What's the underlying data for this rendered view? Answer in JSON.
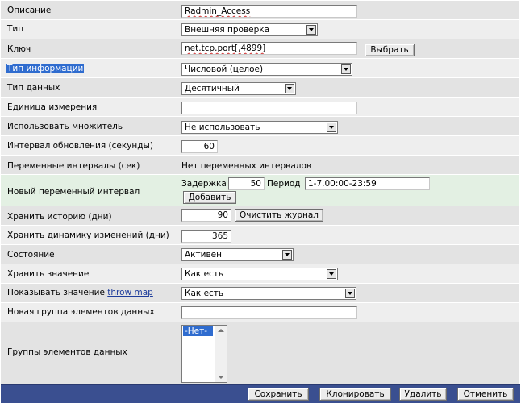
{
  "form": {
    "description": {
      "label": "Описание",
      "value": "Radmin_Access"
    },
    "type": {
      "label": "Тип",
      "value": "Внешняя проверка"
    },
    "key": {
      "label": "Ключ",
      "value": "net.tcp.port[,4899]",
      "button": "Выбрать"
    },
    "info_type": {
      "label": "Тип информации",
      "value": "Числовой (целое)"
    },
    "data_type": {
      "label": "Тип данных",
      "value": "Десятичный"
    },
    "units": {
      "label": "Единица измерения",
      "value": ""
    },
    "multiplier": {
      "label": "Использовать множитель",
      "value": "Не использовать"
    },
    "update_interval": {
      "label": "Интервал обновления (секунды)",
      "value": "60"
    },
    "flexible_intervals": {
      "label": "Переменные интервалы (сек)",
      "value": "Нет переменных интервалов"
    },
    "new_flexible": {
      "label": "Новый переменный интервал",
      "delay_label": "Задержка",
      "delay_value": "50",
      "period_label": "Период",
      "period_value": "1-7,00:00-23:59",
      "add_button": "Добавить"
    },
    "history": {
      "label": "Хранить историю (дни)",
      "value": "90",
      "button": "Очистить журнал"
    },
    "trends": {
      "label": "Хранить динамику изменений (дни)",
      "value": "365"
    },
    "status": {
      "label": "Состояние",
      "value": "Активен"
    },
    "store_value": {
      "label": "Хранить значение",
      "value": "Как есть"
    },
    "show_value": {
      "label": "Показывать значение",
      "link": "throw map",
      "value": "Как есть"
    },
    "new_application": {
      "label": "Новая группа элементов данных",
      "value": ""
    },
    "applications": {
      "label": "Группы элементов данных",
      "options": [
        "-Нет-"
      ]
    }
  },
  "footer": {
    "save": "Сохранить",
    "clone": "Клонировать",
    "delete": "Удалить",
    "cancel": "Отменить"
  },
  "colors": {
    "footer_bg": "#3a4f90",
    "selection": "#2f6ccf",
    "row_odd": "#e3e3e3",
    "row_even": "#eeeeee",
    "row_highlight": "#e3f0e3"
  }
}
